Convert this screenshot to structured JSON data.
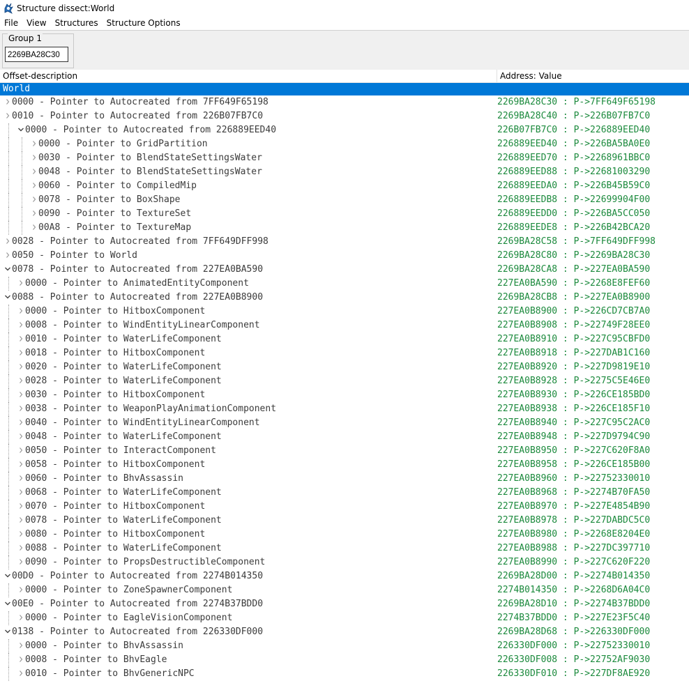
{
  "window": {
    "title": "Structure dissect:World",
    "app_icon": "cheat-engine-icon"
  },
  "menu": [
    "File",
    "View",
    "Structures",
    "Structure Options"
  ],
  "group": {
    "label": "Group 1",
    "address": "2269BA28C30"
  },
  "columns": {
    "offset": "Offset-description",
    "address": "Address: Value"
  },
  "root": "World",
  "colors": {
    "selection": "#0078d7",
    "address_text": "#1c8a3d",
    "offset_text": "#3b3b3b"
  },
  "rows": [
    {
      "depth": 0,
      "state": "collapsed",
      "text": "0000 - Pointer to Autocreated from 7FF649F65198",
      "value": "2269BA28C30 : P->7FF649F65198"
    },
    {
      "depth": 0,
      "state": "collapsed",
      "text": "0010 - Pointer to Autocreated from 226B07FB7C0",
      "value": "2269BA28C40 : P->226B07FB7C0"
    },
    {
      "depth": 1,
      "state": "expanded",
      "text": "0000 - Pointer to Autocreated from 226889EED40",
      "value": "226B07FB7C0 : P->226889EED40"
    },
    {
      "depth": 2,
      "state": "collapsed",
      "text": "0000 - Pointer to GridPartition",
      "value": "226889EED40 : P->226BA5BA0E0"
    },
    {
      "depth": 2,
      "state": "collapsed",
      "text": "0030 - Pointer to BlendStateSettingsWater",
      "value": "226889EED70 : P->2268961BBC0"
    },
    {
      "depth": 2,
      "state": "collapsed",
      "text": "0048 - Pointer to BlendStateSettingsWater",
      "value": "226889EED88 : P->22681003290"
    },
    {
      "depth": 2,
      "state": "collapsed",
      "text": "0060 - Pointer to CompiledMip",
      "value": "226889EEDA0 : P->226B45B59C0"
    },
    {
      "depth": 2,
      "state": "collapsed",
      "text": "0078 - Pointer to BoxShape",
      "value": "226889EEDB8 : P->22699904F00"
    },
    {
      "depth": 2,
      "state": "collapsed",
      "text": "0090 - Pointer to TextureSet",
      "value": "226889EEDD0 : P->226BA5CC050"
    },
    {
      "depth": 2,
      "state": "collapsed",
      "text": "00A8 - Pointer to TextureMap",
      "value": "226889EEDE8 : P->226B42BCA20"
    },
    {
      "depth": 0,
      "state": "collapsed",
      "text": "0028 - Pointer to Autocreated from 7FF649DFF998",
      "value": "2269BA28C58 : P->7FF649DFF998"
    },
    {
      "depth": 0,
      "state": "collapsed",
      "text": "0050 - Pointer to World",
      "value": "2269BA28C80 : P->2269BA28C30"
    },
    {
      "depth": 0,
      "state": "expanded",
      "text": "0078 - Pointer to Autocreated from 227EA0BA590",
      "value": "2269BA28CA8 : P->227EA0BA590"
    },
    {
      "depth": 1,
      "state": "collapsed",
      "text": "0000 - Pointer to AnimatedEntityComponent",
      "value": "227EA0BA590 : P->2268E8FEF60"
    },
    {
      "depth": 0,
      "state": "expanded",
      "text": "0088 - Pointer to Autocreated from 227EA0B8900",
      "value": "2269BA28CB8 : P->227EA0B8900"
    },
    {
      "depth": 1,
      "state": "collapsed",
      "text": "0000 - Pointer to HitboxComponent",
      "value": "227EA0B8900 : P->226CD7CB7A0"
    },
    {
      "depth": 1,
      "state": "collapsed",
      "text": "0008 - Pointer to WindEntityLinearComponent",
      "value": "227EA0B8908 : P->22749F28EE0"
    },
    {
      "depth": 1,
      "state": "collapsed",
      "text": "0010 - Pointer to WaterLifeComponent",
      "value": "227EA0B8910 : P->227C95CBFD0"
    },
    {
      "depth": 1,
      "state": "collapsed",
      "text": "0018 - Pointer to HitboxComponent",
      "value": "227EA0B8918 : P->227DAB1C160"
    },
    {
      "depth": 1,
      "state": "collapsed",
      "text": "0020 - Pointer to WaterLifeComponent",
      "value": "227EA0B8920 : P->227D9819E10"
    },
    {
      "depth": 1,
      "state": "collapsed",
      "text": "0028 - Pointer to WaterLifeComponent",
      "value": "227EA0B8928 : P->2275C5E46E0"
    },
    {
      "depth": 1,
      "state": "collapsed",
      "text": "0030 - Pointer to HitboxComponent",
      "value": "227EA0B8930 : P->226CE185BD0"
    },
    {
      "depth": 1,
      "state": "collapsed",
      "text": "0038 - Pointer to WeaponPlayAnimationComponent",
      "value": "227EA0B8938 : P->226CE185F10"
    },
    {
      "depth": 1,
      "state": "collapsed",
      "text": "0040 - Pointer to WindEntityLinearComponent",
      "value": "227EA0B8940 : P->227C95C2AC0"
    },
    {
      "depth": 1,
      "state": "collapsed",
      "text": "0048 - Pointer to WaterLifeComponent",
      "value": "227EA0B8948 : P->227D9794C90"
    },
    {
      "depth": 1,
      "state": "collapsed",
      "text": "0050 - Pointer to InteractComponent",
      "value": "227EA0B8950 : P->227C620F8A0"
    },
    {
      "depth": 1,
      "state": "collapsed",
      "text": "0058 - Pointer to HitboxComponent",
      "value": "227EA0B8958 : P->226CE185B00"
    },
    {
      "depth": 1,
      "state": "collapsed",
      "text": "0060 - Pointer to BhvAssassin",
      "value": "227EA0B8960 : P->22752330010"
    },
    {
      "depth": 1,
      "state": "collapsed",
      "text": "0068 - Pointer to WaterLifeComponent",
      "value": "227EA0B8968 : P->2274B70FA50"
    },
    {
      "depth": 1,
      "state": "collapsed",
      "text": "0070 - Pointer to HitboxComponent",
      "value": "227EA0B8970 : P->227E4854B90"
    },
    {
      "depth": 1,
      "state": "collapsed",
      "text": "0078 - Pointer to WaterLifeComponent",
      "value": "227EA0B8978 : P->227DABDC5C0"
    },
    {
      "depth": 1,
      "state": "collapsed",
      "text": "0080 - Pointer to HitboxComponent",
      "value": "227EA0B8980 : P->2268E8204E0"
    },
    {
      "depth": 1,
      "state": "collapsed",
      "text": "0088 - Pointer to WaterLifeComponent",
      "value": "227EA0B8988 : P->227DC397710"
    },
    {
      "depth": 1,
      "state": "collapsed",
      "text": "0090 - Pointer to PropsDestructibleComponent",
      "value": "227EA0B8990 : P->227C620F220"
    },
    {
      "depth": 0,
      "state": "expanded",
      "text": "00D0 - Pointer to Autocreated from 2274B014350",
      "value": "2269BA28D00 : P->2274B014350"
    },
    {
      "depth": 1,
      "state": "collapsed",
      "text": "0000 - Pointer to ZoneSpawnerComponent",
      "value": "2274B014350 : P->2268D6A04C0"
    },
    {
      "depth": 0,
      "state": "expanded",
      "text": "00E0 - Pointer to Autocreated from 2274B37BDD0",
      "value": "2269BA28D10 : P->2274B37BDD0"
    },
    {
      "depth": 1,
      "state": "collapsed",
      "text": "0000 - Pointer to EagleVisionComponent",
      "value": "2274B37BDD0 : P->227E23F5C40"
    },
    {
      "depth": 0,
      "state": "expanded",
      "text": "0138 - Pointer to Autocreated from 226330DF000",
      "value": "2269BA28D68 : P->226330DF000"
    },
    {
      "depth": 1,
      "state": "collapsed",
      "text": "0000 - Pointer to BhvAssassin",
      "value": "226330DF000 : P->22752330010"
    },
    {
      "depth": 1,
      "state": "collapsed",
      "text": "0008 - Pointer to BhvEagle",
      "value": "226330DF008 : P->22752AF9030"
    },
    {
      "depth": 1,
      "state": "collapsed",
      "text": "0010 - Pointer to BhvGenericNPC",
      "value": "226330DF010 : P->227DF8AE920"
    }
  ]
}
